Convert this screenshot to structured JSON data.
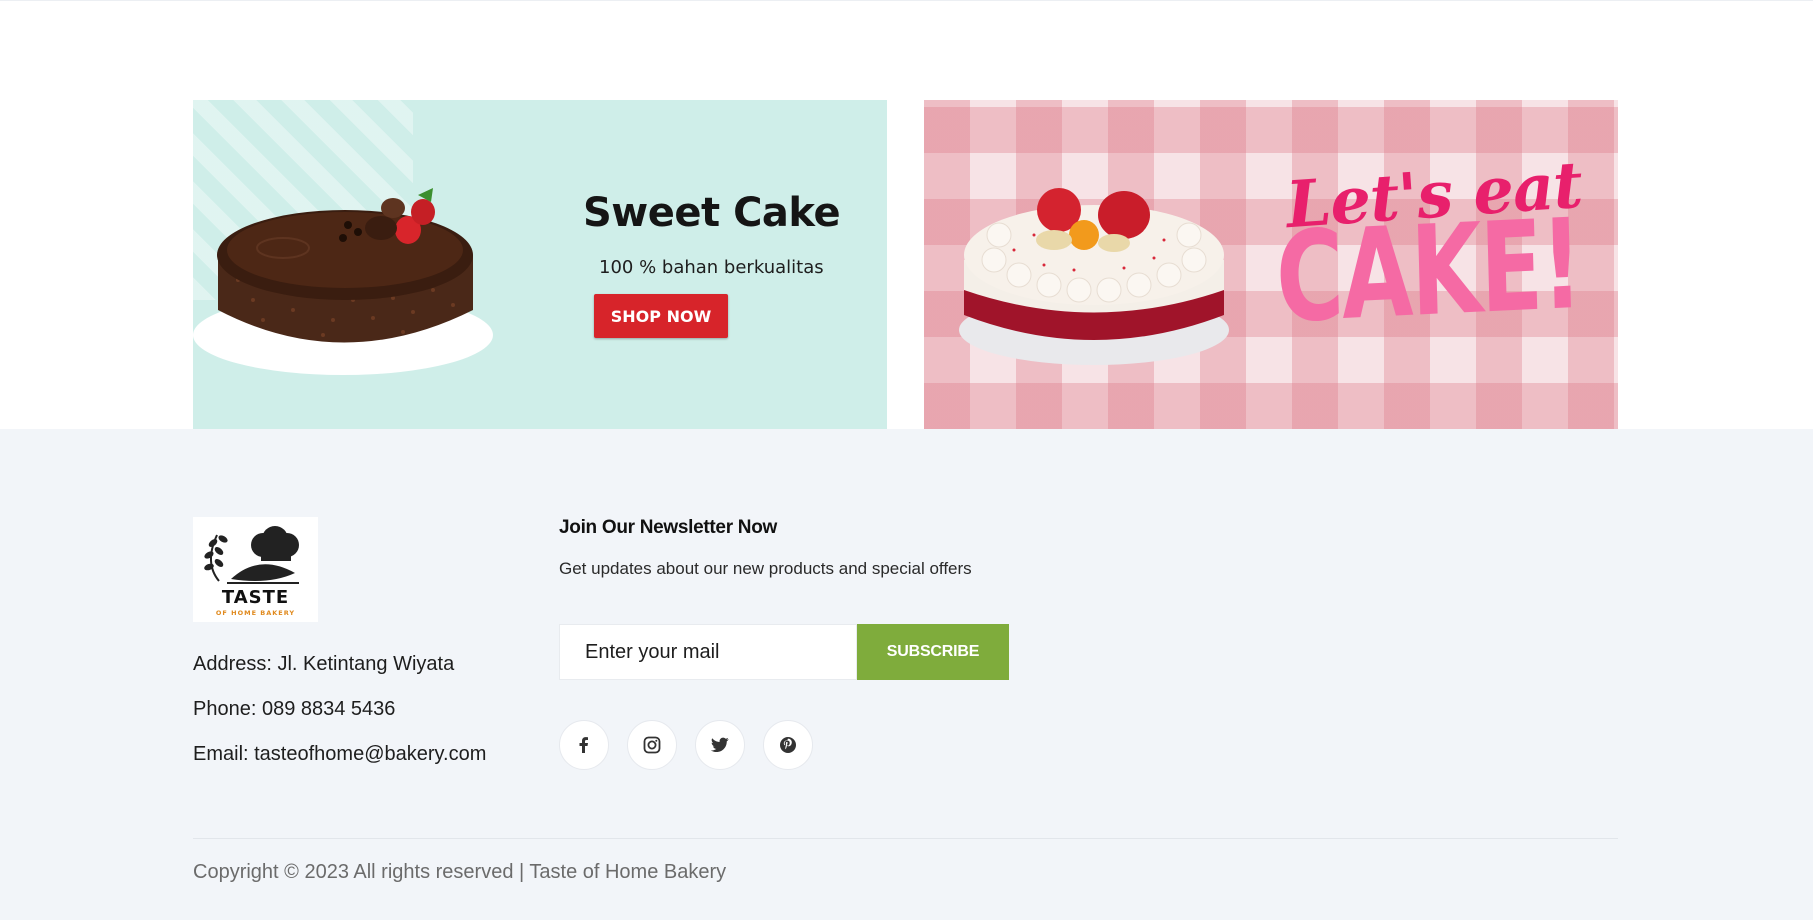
{
  "banners": {
    "left": {
      "title": "Sweet Cake",
      "subtitle": "100 % bahan berkualitas",
      "button_label": "SHOP NOW",
      "background_color": "#cfeee9",
      "button_color": "#d7242a"
    },
    "right": {
      "headline_line1": "Let's eat",
      "headline_line2": "CAKE!",
      "background_color": "#f5d7dc",
      "headline_color1": "#e8206c",
      "headline_color2": "#f56aa4"
    }
  },
  "footer": {
    "logo": {
      "name": "TASTE",
      "tagline": "OF HOME BAKERY",
      "icon": "chef-hat-bread-icon"
    },
    "contact": {
      "address": "Address: Jl. Ketintang Wiyata",
      "phone": "Phone: 089 8834 5436",
      "email": "Email: tasteofhome@bakery.com"
    },
    "newsletter": {
      "title": "Join Our Newsletter Now",
      "subtitle": "Get updates about our new products and special offers",
      "input_placeholder": "Enter your mail",
      "button_label": "SUBSCRIBE",
      "button_color": "#7fac3c"
    },
    "social": [
      {
        "icon": "facebook-icon"
      },
      {
        "icon": "instagram-icon"
      },
      {
        "icon": "twitter-icon"
      },
      {
        "icon": "pinterest-icon"
      }
    ],
    "copyright": "Copyright © 2023 All rights reserved | Taste of Home Bakery",
    "background_color": "#f2f5f9"
  }
}
